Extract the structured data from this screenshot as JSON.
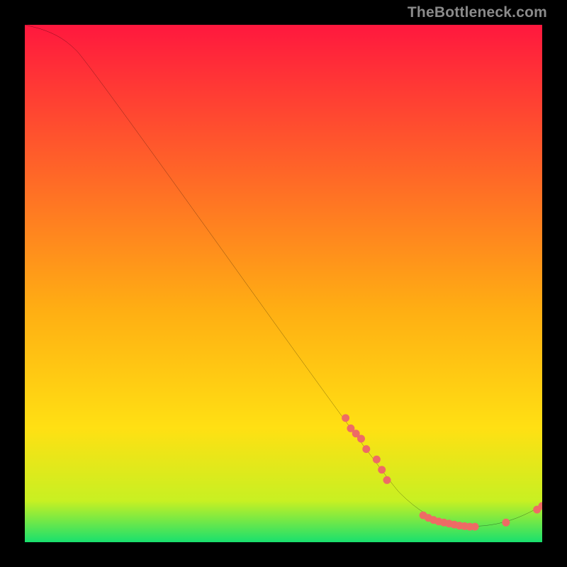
{
  "watermark": "TheBottleneck.com",
  "colors": {
    "top": "#ff183e",
    "mid": "#ffe013",
    "bottom": "#18e06e",
    "line": "#000000",
    "marker": "#ee6b65"
  },
  "chart_data": {
    "type": "line",
    "title": "",
    "xlabel": "",
    "ylabel": "",
    "xlim": [
      0,
      100
    ],
    "ylim": [
      0,
      100
    ],
    "curve": [
      {
        "x": 0,
        "y": 100
      },
      {
        "x": 4,
        "y": 99
      },
      {
        "x": 8,
        "y": 97
      },
      {
        "x": 12,
        "y": 93
      },
      {
        "x": 70,
        "y": 12
      },
      {
        "x": 75,
        "y": 7
      },
      {
        "x": 80,
        "y": 4
      },
      {
        "x": 85,
        "y": 3
      },
      {
        "x": 90,
        "y": 3.2
      },
      {
        "x": 95,
        "y": 4.5
      },
      {
        "x": 100,
        "y": 7
      }
    ],
    "markers": [
      {
        "x": 62,
        "y": 24
      },
      {
        "x": 63,
        "y": 22
      },
      {
        "x": 64,
        "y": 21
      },
      {
        "x": 65,
        "y": 20
      },
      {
        "x": 66,
        "y": 18
      },
      {
        "x": 68,
        "y": 16
      },
      {
        "x": 69,
        "y": 14
      },
      {
        "x": 70,
        "y": 12
      },
      {
        "x": 77,
        "y": 5.2
      },
      {
        "x": 78,
        "y": 4.7
      },
      {
        "x": 79,
        "y": 4.3
      },
      {
        "x": 80,
        "y": 4.0
      },
      {
        "x": 81,
        "y": 3.8
      },
      {
        "x": 82,
        "y": 3.6
      },
      {
        "x": 83,
        "y": 3.4
      },
      {
        "x": 84,
        "y": 3.2
      },
      {
        "x": 85,
        "y": 3.1
      },
      {
        "x": 86,
        "y": 3.0
      },
      {
        "x": 87,
        "y": 3.0
      },
      {
        "x": 93,
        "y": 3.8
      },
      {
        "x": 99,
        "y": 6.3
      },
      {
        "x": 100,
        "y": 7.0
      }
    ]
  }
}
